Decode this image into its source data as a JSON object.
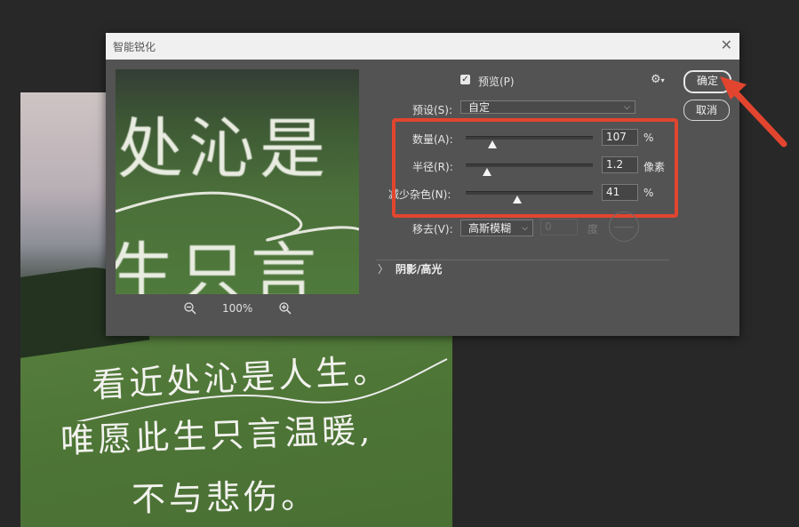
{
  "dialog": {
    "title": "智能锐化",
    "close_glyph": "✕",
    "preview_checkbox_label": "预览(P)",
    "preview_checked": true,
    "ok_label": "确定",
    "cancel_label": "取消",
    "preset_label": "预设(S):",
    "preset_value": "自定",
    "amount_label": "数量(A):",
    "amount_value": "107",
    "amount_unit": "%",
    "radius_label": "半径(R):",
    "radius_value": "1.2",
    "radius_unit": "像素",
    "noise_label": "减少杂色(N):",
    "noise_value": "41",
    "noise_unit": "%",
    "remove_label": "移去(V):",
    "remove_value": "高斯模糊",
    "angle_value": "0",
    "angle_unit": "度",
    "section_label": "阴影/高光",
    "section_caret": "〉"
  },
  "preview_pane": {
    "zoom_value": "100%",
    "text_line_1": "处沁是",
    "text_line_2": "生只言"
  },
  "document": {
    "line_1": "看近处沁是人生。",
    "line_2": "唯愿此生只言温暖,",
    "line_3": "不与悲伤。"
  },
  "icons": {
    "zoom_out": "zoom-out-icon",
    "zoom_in": "zoom-in-icon",
    "gear": "gear-icon",
    "close": "close-icon",
    "chevron": "chevron-down-icon"
  },
  "colors": {
    "highlight": "#e2452f",
    "dialog_bg": "#535353",
    "app_bg": "#282828"
  }
}
